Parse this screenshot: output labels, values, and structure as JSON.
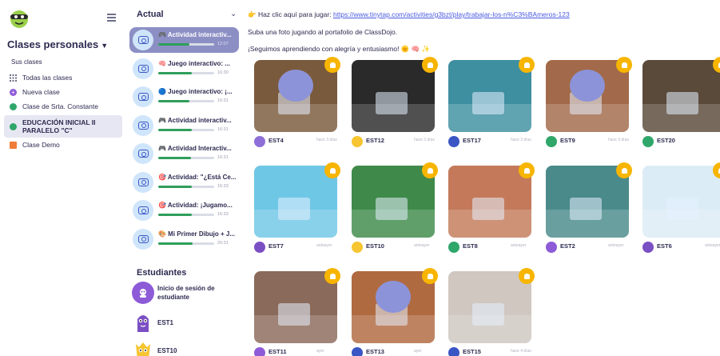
{
  "sidebar": {
    "title": "Clases personales",
    "section_label": "Sus clases",
    "items": [
      {
        "label": "Todas las clases",
        "icon": "grid-icon",
        "color": "#6d6f8a"
      },
      {
        "label": "Nueva clase",
        "icon": "plus-circle-icon",
        "color": "#8e5bd8"
      },
      {
        "label": "Clase de Srta. Constante",
        "icon": "globe-icon",
        "color": "#2fa66a"
      },
      {
        "label": "EDUCACIÓN INICIAL II PARALELO \"C\"",
        "icon": "globe-icon",
        "color": "#2fa66a",
        "active": true
      },
      {
        "label": "Clase Demo",
        "icon": "book-icon",
        "color": "#f07c38"
      }
    ]
  },
  "stories": {
    "header": "Actual",
    "items": [
      {
        "title": "🎮 Actividad interactiv...",
        "time": "12:07",
        "progress": 0.55,
        "active": true
      },
      {
        "title": "🧠 Juego interactivo: ...",
        "time": "16:30",
        "progress": 0.6
      },
      {
        "title": "🔵 Juego interactivo: ¡...",
        "time": "16:31",
        "progress": 0.55
      },
      {
        "title": "🎮 Actividad interactiv...",
        "time": "16:31",
        "progress": 0.6
      },
      {
        "title": "🎮 Actividad Interactiv...",
        "time": "16:31",
        "progress": 0.58
      },
      {
        "title": "🎯 Actividad: \"¿Está Ce...",
        "time": "16:33",
        "progress": 0.6
      },
      {
        "title": "🎯 Actividad: ¡Jugamo...",
        "time": "16:33",
        "progress": 0.6
      },
      {
        "title": "🎨 Mi Primer Dibujo + J...",
        "time": "20:31",
        "progress": 0.62
      }
    ]
  },
  "students": {
    "header": "Estudiantes",
    "items": [
      {
        "label": "Inicio de sesión de estudiante",
        "color": "#8e5bd8"
      },
      {
        "label": "EST1",
        "color": "#7b4fc4"
      },
      {
        "label": "EST10",
        "color": "#f7c531"
      }
    ]
  },
  "post": {
    "line1_prefix": "👉 Haz clic aquí para jugar: ",
    "link": "https://www.tinytap.com/activities/g3bzt/play/trabajar-los-n%C3%BAmeros-123",
    "line2": "Suba una foto jugando al portafolio de ClassDojo.",
    "line3": "¡Seguimos aprendiendo con alegría y entusiasmo! 🌞 🧠 ✨"
  },
  "cards": [
    {
      "name": "EST4",
      "time": "hace 3 días",
      "photo": "#7a5a3c",
      "av": "#8e6fd8",
      "face": true
    },
    {
      "name": "EST12",
      "time": "hace 3 días",
      "photo": "#2a2a2a",
      "av": "#f7c531"
    },
    {
      "name": "EST17",
      "time": "hace 3 días",
      "photo": "#3e8fa0",
      "av": "#3a56c4"
    },
    {
      "name": "EST9",
      "time": "hace 3 días",
      "photo": "#a26a4a",
      "av": "#2fa66a",
      "face": true
    },
    {
      "name": "EST20",
      "time": "",
      "photo": "#5a4a3a",
      "av": "#2fa66a"
    },
    {
      "name": "EST7",
      "time": "anteayer",
      "photo": "#6fc7e6",
      "av": "#7b4fc4"
    },
    {
      "name": "EST10",
      "time": "anteayer",
      "photo": "#3f8a4a",
      "av": "#f7c531"
    },
    {
      "name": "EST8",
      "time": "anteayer",
      "photo": "#c47a5a",
      "av": "#2fa66a"
    },
    {
      "name": "EST2",
      "time": "anteayer",
      "photo": "#4a8a8a",
      "av": "#8e5bd8"
    },
    {
      "name": "EST6",
      "time": "anteayer",
      "photo": "#dcecf6",
      "av": "#7b4fc4"
    },
    {
      "name": "EST11",
      "time": "ayer",
      "photo": "#8a6a5a",
      "av": "#8e5bd8"
    },
    {
      "name": "EST13",
      "time": "ayer",
      "photo": "#b06a40",
      "av": "#3a56c4",
      "face": true
    },
    {
      "name": "EST15",
      "time": "hace 4 días",
      "photo": "#cfc7c0",
      "av": "#3a56c4"
    }
  ]
}
